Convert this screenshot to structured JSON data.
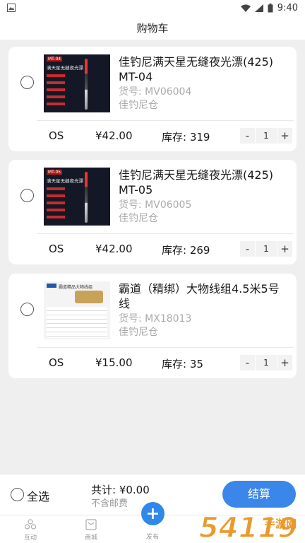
{
  "status_bar": {
    "time": "9:40"
  },
  "header": {
    "title": "购物车"
  },
  "cart_items": [
    {
      "name": "佳钓尼满天星无缝夜光漂(425) MT-04",
      "code": "货号: MV06004",
      "store": "佳钓尼仓",
      "spec": "OS",
      "price": "¥42.00",
      "stock": "库存: 319",
      "quantity": "1",
      "thumb_tag": "MT-04",
      "thumb_sub": "满天星无缝夜光漂"
    },
    {
      "name": "佳钓尼满天星无缝夜光漂(425) MT-05",
      "code": "货号: MV06005",
      "store": "佳钓尼仓",
      "spec": "OS",
      "price": "¥42.00",
      "stock": "库存: 269",
      "quantity": "1",
      "thumb_tag": "MT-05",
      "thumb_sub": "满天星无缝夜光漂"
    },
    {
      "name": "霸道（精绑）大物线组4.5米5号线",
      "code": "货号: MX18013",
      "store": "佳钓尼仓",
      "spec": "OS",
      "price": "¥15.00",
      "stock": "库存: 35",
      "quantity": "1",
      "thumb_tag": "霸道精品大物线组"
    }
  ],
  "stepper": {
    "minus": "-",
    "plus": "+"
  },
  "footer": {
    "select_all": "全选",
    "total": "共计: ¥0.00",
    "no_shipping": "不含邮费",
    "checkout": "结算"
  },
  "tabs": [
    {
      "label": "互动",
      "icon": "community-icon"
    },
    {
      "label": "商城",
      "icon": "shop-icon"
    },
    {
      "label": "发布",
      "icon": "plus-icon"
    }
  ],
  "watermark": {
    "text": "54119手游网",
    "color": "#e89a2c"
  },
  "colors": {
    "accent": "#3a86e9",
    "background": "#efefef"
  }
}
